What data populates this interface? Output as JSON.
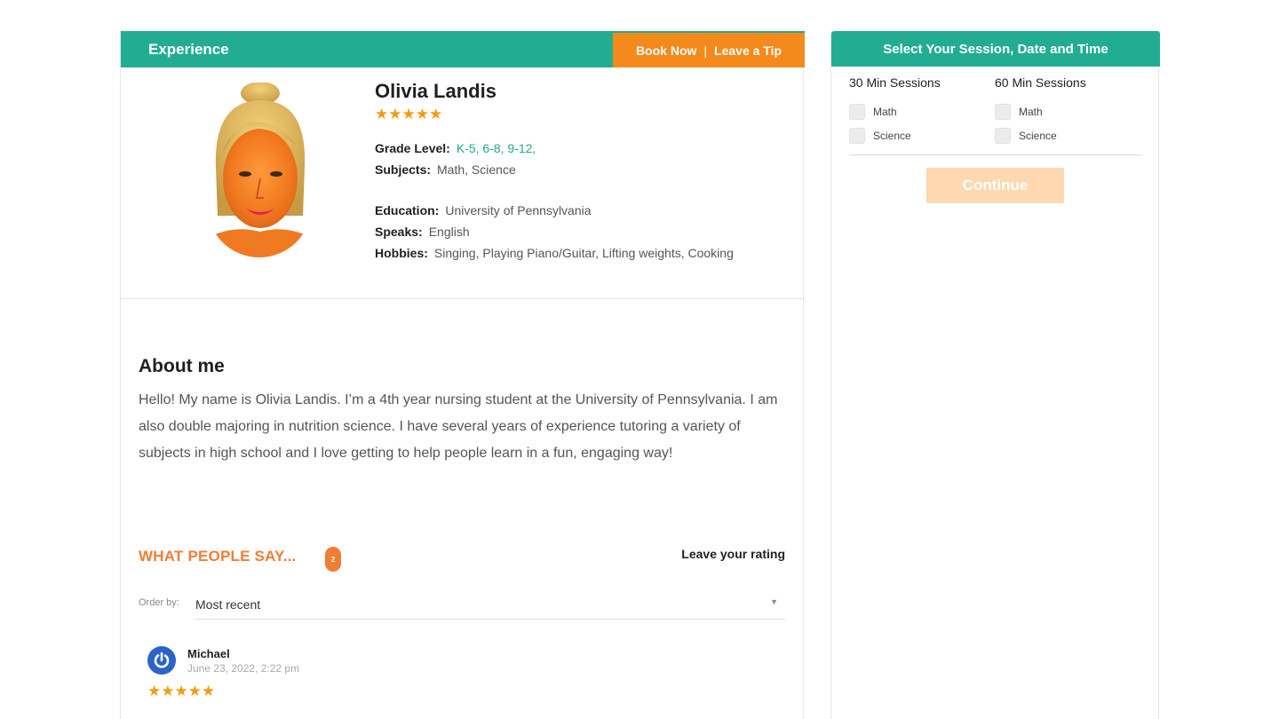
{
  "header": {
    "title": "Experience",
    "book_now": "Book Now",
    "separator": "|",
    "leave_tip": "Leave a Tip"
  },
  "profile": {
    "name": "Olivia Landis",
    "rating_stars": "★★★★★",
    "grade_label": "Grade Level:",
    "grade_value": "K-5, 6-8, 9-12,",
    "subjects_label": "Subjects:",
    "subjects_value": "Math, Science",
    "education_label": "Education:",
    "education_value": "University of Pennsylvania",
    "speaks_label": "Speaks:",
    "speaks_value": "English",
    "hobbies_label": "Hobbies:",
    "hobbies_value": "Singing, Playing Piano/Guitar, Lifting weights, Cooking"
  },
  "about": {
    "heading": "About me",
    "text": "Hello! My name is Olivia Landis. I’m a 4th year nursing student at the University of Pennsylvania. I am also double majoring in nutrition science. I have several years of experience tutoring a variety of subjects in high school and I love getting to help people learn in a fun, engaging way!"
  },
  "reviews": {
    "heading": "WHAT PEOPLE SAY...",
    "count": "2",
    "leave_rating": "Leave your rating",
    "order_label": "Order by:",
    "order_value": "Most recent",
    "items": [
      {
        "name": "Michael",
        "date": "June 23, 2022, 2:22 pm",
        "stars": "★★★★★"
      }
    ]
  },
  "booking": {
    "title": "Select Your Session, Date and Time",
    "col1_title": "30 Min Sessions",
    "col1_options": [
      "Math",
      "Science"
    ],
    "col2_title": "60 Min Sessions",
    "col2_options": [
      "Math",
      "Science"
    ],
    "continue_label": "Continue"
  },
  "colors": {
    "teal": "#22ad92",
    "orange": "#f48a1b",
    "star": "#f39c12",
    "continue_disabled": "#fdd8b0"
  }
}
